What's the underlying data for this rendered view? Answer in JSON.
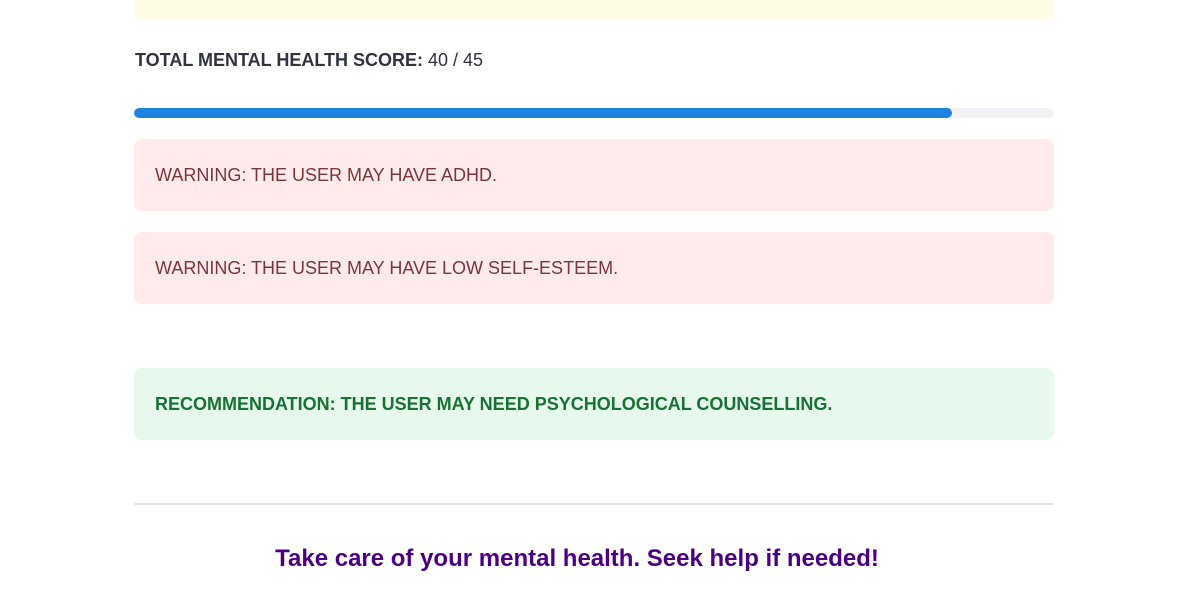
{
  "score": {
    "label": "TOTAL MENTAL HEALTH SCORE:",
    "value": "40 / 45",
    "progress_fraction": 0.889
  },
  "alerts": {
    "warning_1": "WARNING: THE USER MAY HAVE ADHD.",
    "warning_2": "WARNING: THE USER MAY HAVE LOW SELF-ESTEEM.",
    "recommendation": "RECOMMENDATION: THE USER MAY NEED PSYCHOLOGICAL COUNSELLING."
  },
  "footer": {
    "message": "Take care of your mental health. Seek help if needed!"
  },
  "colors": {
    "progress": "#1c83e1",
    "warning_bg": "#ffebeb",
    "warning_text": "#7d353b",
    "success_bg": "#e7f8ec",
    "success_text": "#177233",
    "footer_text": "#4b0082"
  }
}
